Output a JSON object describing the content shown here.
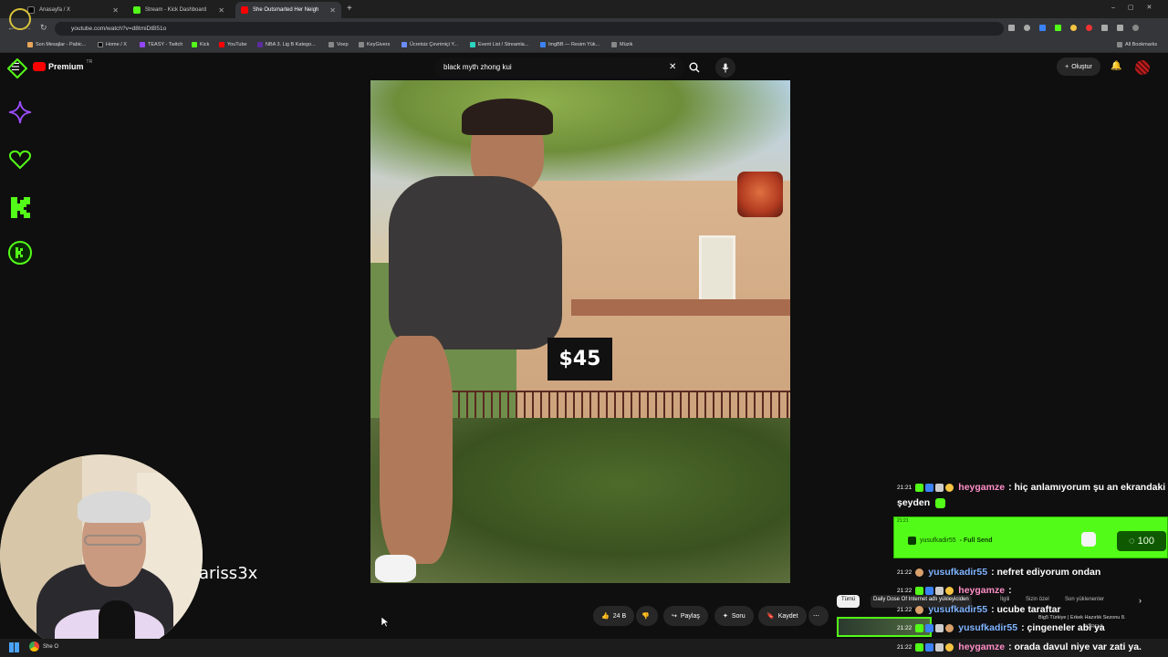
{
  "tabs": [
    {
      "label": "Anasayfa / X",
      "color": "#000000"
    },
    {
      "label": "Stream - Kick Dashboard",
      "color": "#53fc18"
    },
    {
      "label": "She Outsmarted Her Neigh",
      "color": "#ff0000"
    }
  ],
  "url": "youtube.com/watch?v=d8tmiDtB51o",
  "bookmarks": [
    "Son Mesajlar - Pabic...",
    "Home / X",
    "TEASY - Twitch",
    "Kick",
    "YouTube",
    "NBA 3. Lig B Katego...",
    "Voep",
    "KeyGivers",
    "Ücretsiz Çevrimiçi Y...",
    "Event List / Streamla...",
    "ImgBB — Resim Yük...",
    "Müzik",
    "All Bookmarks"
  ],
  "youtube": {
    "brand": "Premium",
    "region": "TR",
    "search_value": "black myth zhong kui",
    "create_label": "Oluştur"
  },
  "video": {
    "price_label": "$45",
    "overlay_name": "ariss3x"
  },
  "actions": {
    "likes": "24 B",
    "share": "Paylaş",
    "ask": "Soru",
    "save": "Kaydet"
  },
  "chips": [
    "Tümü",
    "Daily Dose Of Internet adlı yükleyiciden",
    "İlgili",
    "Sizin özel",
    "Son yüklenenler"
  ],
  "recommendation": {
    "title": "Big5 Türkiye | Erkek Hazırlık Sezonu 8.",
    "subtitle": "GÖREVİ"
  },
  "chat": [
    {
      "time": "21:21",
      "user": "heygamze",
      "user_color": "#ff8fc8",
      "text": ": hiç anlamıyorum şu an ekrandaki"
    },
    {
      "time": "",
      "user": "",
      "user_color": "#ffffff",
      "text": "şeyden"
    },
    {
      "time": "21:22",
      "user": "yusufkadir55",
      "user_color": "#7fb3ff",
      "text": ": nefret ediyorum ondan"
    },
    {
      "time": "21:22",
      "user": "heygamze",
      "user_color": "#ff8fc8",
      "text": ":"
    },
    {
      "time": "21:22",
      "user": "yusufkadir55",
      "user_color": "#7fb3ff",
      "text": ": ucube taraftar"
    },
    {
      "time": "21:22",
      "user": "yusufkadir55",
      "user_color": "#7fb3ff",
      "text": ": çingeneler abi ya"
    },
    {
      "time": "21:22",
      "user": "heygamze",
      "user_color": "#ff8fc8",
      "text": ": orada davul niye var zati ya."
    }
  ],
  "send_alert": {
    "time": "21:21",
    "user": "yusufkadir55",
    "label": "- Full Send",
    "amount": "100"
  },
  "taskbar": {
    "chrome_label": "She O"
  },
  "colors": {
    "kick_green": "#53fc18",
    "yt_red": "#ff0000"
  }
}
